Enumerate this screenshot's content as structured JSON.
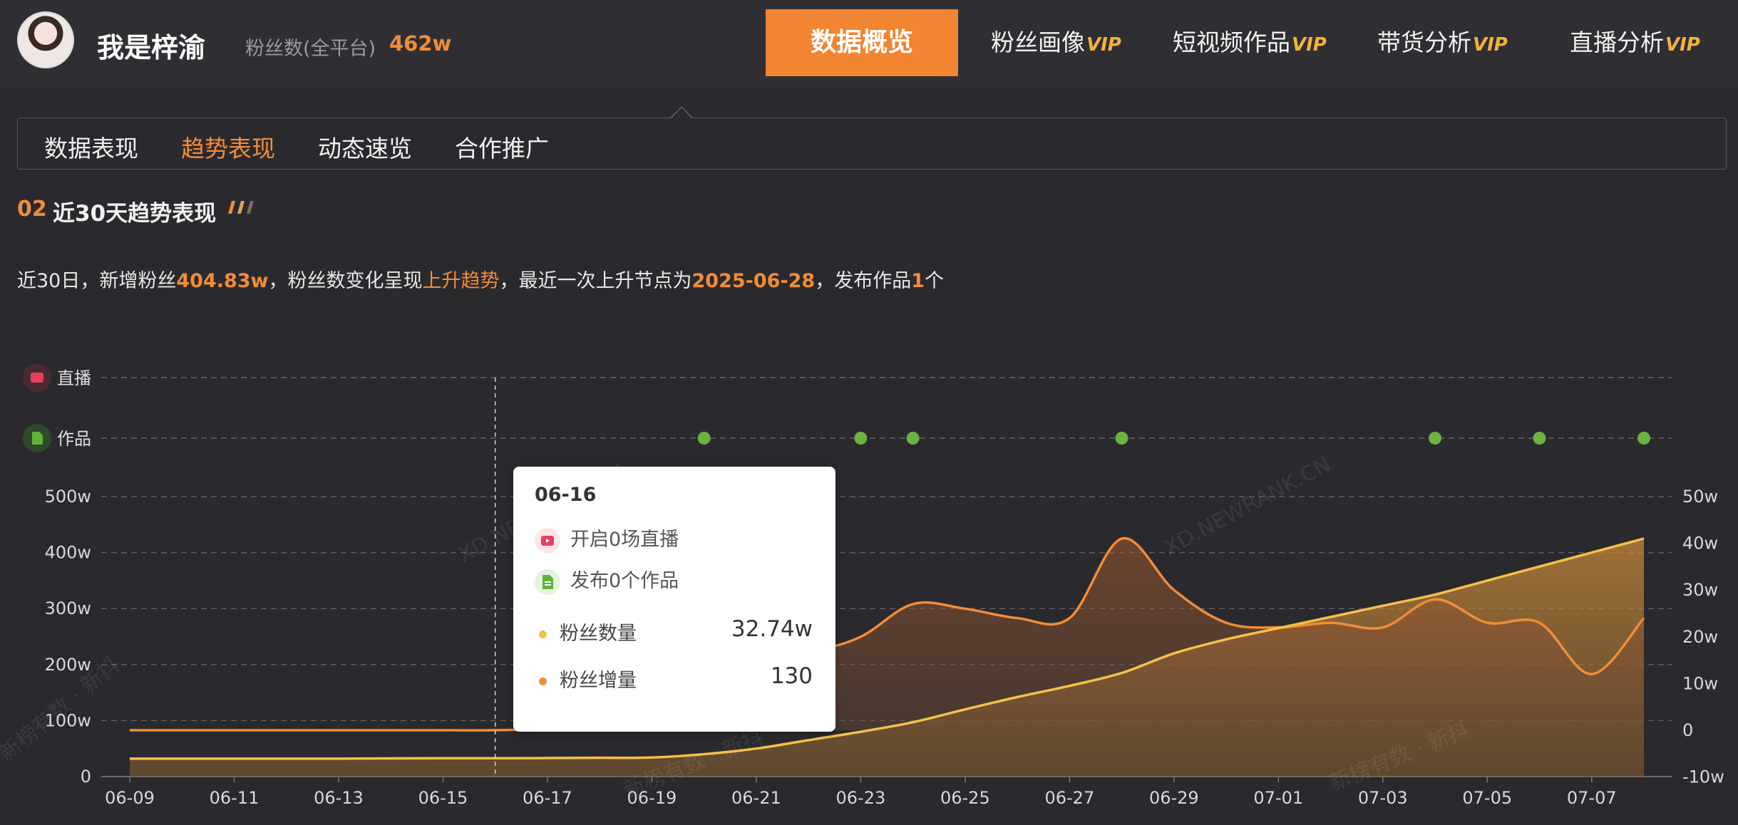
{
  "header": {
    "username": "我是梓渝",
    "fans_label": "粉丝数(全平台)",
    "fans_value": "462w",
    "tabs": [
      {
        "label": "数据概览",
        "vip": ""
      },
      {
        "label": "粉丝画像",
        "vip": "VIP"
      },
      {
        "label": "短视频作品",
        "vip": "VIP"
      },
      {
        "label": "带货分析",
        "vip": "VIP"
      },
      {
        "label": "直播分析",
        "vip": "VIP"
      }
    ]
  },
  "subtabs": [
    "数据表现",
    "趋势表现",
    "动态速览",
    "合作推广"
  ],
  "section": {
    "number": "02",
    "title": "近30天趋势表现"
  },
  "summary": {
    "p1": "近30日，新增粉丝",
    "new_fans": "404.83w",
    "p2": "，粉丝数变化呈现",
    "trend": "上升趋势",
    "p3": "，最近一次上升节点为",
    "last_rise": "2025-06-28",
    "p4": "，发布作品",
    "works": "1",
    "p5": "个"
  },
  "tooltip": {
    "date": "06-16",
    "live_text": "开启0场直播",
    "works_text": "发布0个作品",
    "fans_label": "粉丝数量",
    "fans_value": "32.74w",
    "inc_label": "粉丝增量",
    "inc_value": "130"
  },
  "watermarks": [
    "XD.NEWRANK.CN",
    "新榜有数 · 新抖"
  ],
  "colors": {
    "accent": "#f28c38",
    "fans_line": "#f5c04a",
    "increment_line": "#f28c38",
    "event_dot": "#6cb33f"
  },
  "chart_data": {
    "type": "area",
    "x": [
      "06-09",
      "06-10",
      "06-11",
      "06-12",
      "06-13",
      "06-14",
      "06-15",
      "06-16",
      "06-17",
      "06-18",
      "06-19",
      "06-20",
      "06-21",
      "06-22",
      "06-23",
      "06-24",
      "06-25",
      "06-26",
      "06-27",
      "06-28",
      "06-29",
      "06-30",
      "07-01",
      "07-02",
      "07-03",
      "07-04",
      "07-05",
      "07-06",
      "07-07",
      "07-08"
    ],
    "x_tick_labels": [
      "06-09",
      "06-11",
      "06-13",
      "06-15",
      "06-17",
      "06-19",
      "06-21",
      "06-23",
      "06-25",
      "06-27",
      "06-29",
      "07-01",
      "07-03",
      "07-05",
      "07-07"
    ],
    "left_axis": {
      "ticks": [
        "0",
        "100w",
        "200w",
        "300w",
        "400w",
        "500w"
      ],
      "range": [
        0,
        500
      ]
    },
    "right_axis": {
      "ticks": [
        "-10w",
        "0",
        "10w",
        "20w",
        "30w",
        "40w",
        "50w"
      ],
      "range": [
        -10,
        50
      ]
    },
    "event_rows": [
      "直播",
      "作品"
    ],
    "live_events": [],
    "work_events": [
      "06-20",
      "06-23",
      "06-24",
      "06-28",
      "07-04",
      "07-06",
      "07-08"
    ],
    "series": [
      {
        "name": "粉丝数量",
        "axis": "left",
        "values": [
          32,
          32,
          32,
          32,
          32,
          32.5,
          32.7,
          32.74,
          33,
          33.5,
          34,
          40,
          50,
          65,
          80,
          97,
          120,
          142,
          162,
          185,
          220,
          245,
          265,
          285,
          305,
          325,
          350,
          375,
          400,
          425
        ]
      },
      {
        "name": "粉丝增量",
        "axis": "right",
        "values": [
          0,
          0,
          0,
          0,
          0,
          0,
          0,
          0.013,
          0.5,
          3,
          8,
          12,
          14,
          16.5,
          20,
          27,
          26,
          24,
          24,
          41,
          30,
          23,
          22,
          23,
          22,
          28,
          23,
          23,
          12,
          24
        ]
      }
    ],
    "grid": true,
    "legend": "none"
  }
}
